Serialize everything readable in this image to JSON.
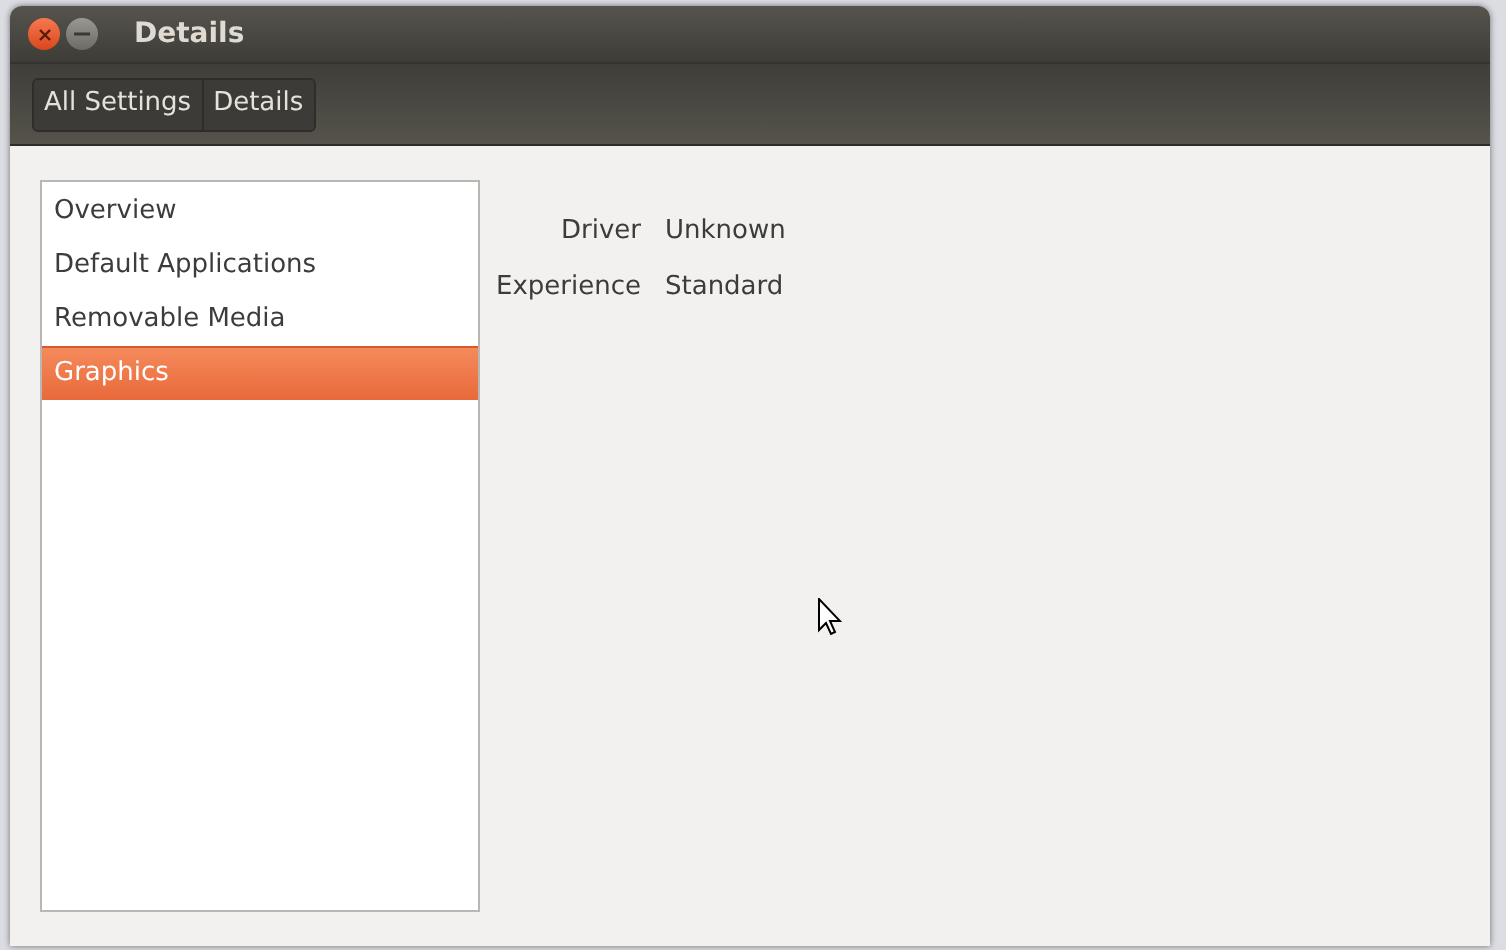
{
  "window": {
    "title": "Details"
  },
  "breadcrumbs": [
    {
      "label": "All Settings"
    },
    {
      "label": "Details"
    }
  ],
  "sidebar": {
    "items": [
      {
        "label": "Overview",
        "selected": false
      },
      {
        "label": "Default Applications",
        "selected": false
      },
      {
        "label": "Removable Media",
        "selected": false
      },
      {
        "label": "Graphics",
        "selected": true
      }
    ]
  },
  "details": [
    {
      "label": "Driver",
      "value": "Unknown"
    },
    {
      "label": "Experience",
      "value": "Standard"
    }
  ]
}
